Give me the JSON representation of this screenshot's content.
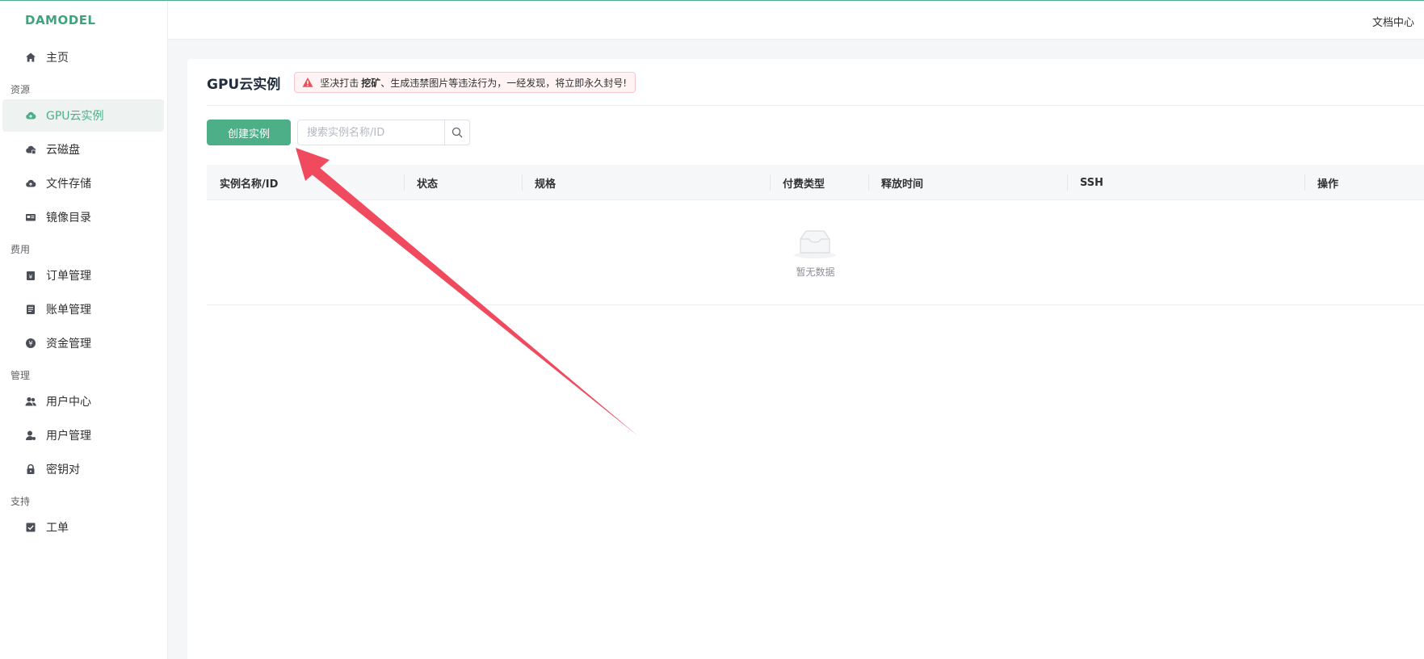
{
  "app": {
    "logo": "DAMODEL"
  },
  "header": {
    "doc_link": "文档中心"
  },
  "sidebar": {
    "home": "主页",
    "sections": [
      {
        "label": "资源",
        "items": [
          "GPU云实例",
          "云磁盘",
          "文件存储",
          "镜像目录"
        ]
      },
      {
        "label": "费用",
        "items": [
          "订单管理",
          "账单管理",
          "资金管理"
        ]
      },
      {
        "label": "管理",
        "items": [
          "用户中心",
          "用户管理",
          "密钥对"
        ]
      },
      {
        "label": "支持",
        "items": [
          "工单"
        ]
      }
    ],
    "active_item": "GPU云实例"
  },
  "main": {
    "title": "GPU云实例",
    "warning": {
      "prefix": "坚决打击",
      "bold": "挖矿",
      "suffix": "、生成违禁图片等违法行为，一经发现，将立即永久封号!"
    },
    "create_button": "创建实例",
    "search": {
      "placeholder": "搜索实例名称/ID",
      "value": ""
    },
    "table": {
      "columns": [
        "实例名称/ID",
        "状态",
        "规格",
        "付费类型",
        "释放时间",
        "SSH",
        "操作"
      ],
      "rows": [],
      "empty_text": "暂无数据"
    }
  },
  "colors": {
    "accent": "#4caf88",
    "warning_red": "#e8505b",
    "annotation_arrow": "#f04a5e"
  },
  "icons": [
    "home-icon",
    "cloud-server-icon",
    "cloud-disk-icon",
    "cloud-storage-icon",
    "image-catalog-icon",
    "order-icon",
    "bill-icon",
    "funds-icon",
    "user-center-icon",
    "user-manage-icon",
    "lock-icon",
    "ticket-icon",
    "warning-icon",
    "search-icon",
    "empty-box-icon"
  ]
}
